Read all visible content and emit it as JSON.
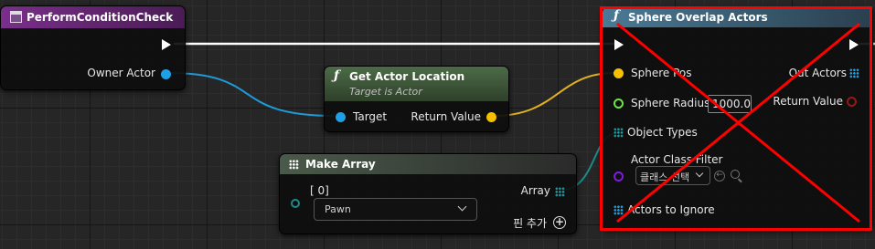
{
  "nodes": {
    "perform_condition_check": {
      "title": "PerformConditionCheck",
      "pins": {
        "owner_actor": "Owner Actor"
      }
    },
    "get_actor_location": {
      "title": "Get Actor Location",
      "subtitle": "Target is Actor",
      "pins": {
        "target": "Target",
        "return_value": "Return Value"
      }
    },
    "make_array": {
      "title": "Make Array",
      "pins": {
        "index0": "[ 0]",
        "array": "Array"
      },
      "dropdown_value": "Pawn",
      "add_pin_label": "핀 추가"
    },
    "sphere_overlap_actors": {
      "title": "Sphere Overlap Actors",
      "pins": {
        "sphere_pos": "Sphere Pos",
        "sphere_radius": "Sphere Radius",
        "sphere_radius_value": "1000.0",
        "object_types": "Object Types",
        "actor_class_filter": "Actor Class Filter",
        "class_select": "클래스 선택",
        "actors_to_ignore": "Actors to Ignore",
        "out_actors": "Out Actors",
        "return_value": "Return Value"
      }
    }
  },
  "colors": {
    "event_header": "#6b2b7a",
    "pure_header": "#3f5a3b",
    "function_header": "#365a72",
    "exec_wire": "#ffffff",
    "object_pin": "#1ea0e6",
    "vector_pin": "#f5c000",
    "float_pin": "#6fe34b",
    "class_pin": "#7a1ed6",
    "bool_pin": "#a01414",
    "struct_pin": "#1e8a8a",
    "annotation_red": "#ff0000"
  }
}
